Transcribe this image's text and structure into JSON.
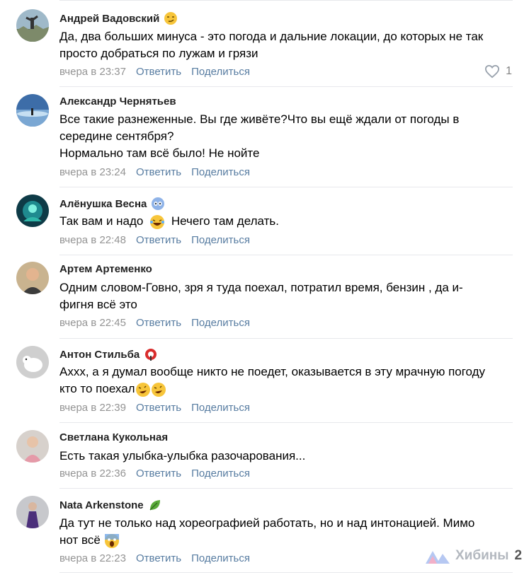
{
  "comments": [
    {
      "author": "Андрей Вадовский",
      "lines": [
        "Да, два больших минуса - это погода и дальние локации, до которых не так",
        "просто добраться по лужам и грязи"
      ],
      "time": "вчера в 23:37",
      "reply_label": "Ответить",
      "share_label": "Поделиться",
      "likes": "1"
    },
    {
      "author": "Александр Чернятьев",
      "lines": [
        "Все такие разнеженные. Вы где живёте?Что вы ещё ждали от погоды в",
        "середине сентября?",
        "Нормально там всё было! Не нойте"
      ],
      "time": "вчера в 23:24",
      "reply_label": "Ответить",
      "share_label": "Поделиться"
    },
    {
      "author": "Алёнушка Весна",
      "lines": [
        "Так вам и надо",
        "Нечего там делать."
      ],
      "time": "вчера в 22:48",
      "reply_label": "Ответить",
      "share_label": "Поделиться"
    },
    {
      "author": "Артем Артеменко",
      "lines": [
        "Одним словом-Говно, зря я туда поехал, потратил время, бензин , да и-",
        "фигня всё это"
      ],
      "time": "вчера в 22:45",
      "reply_label": "Ответить",
      "share_label": "Поделиться"
    },
    {
      "author": "Антон Стильба",
      "lines": [
        "Ахxх, а я думал вообще никто не поедет, оказывается в эту мрачную погоду",
        "кто то поехал"
      ],
      "time": "вчера в 22:39",
      "reply_label": "Ответить",
      "share_label": "Поделиться"
    },
    {
      "author": "Светлана Кукольная",
      "lines": [
        "Есть такая улыбка-улыбка разочарования..."
      ],
      "time": "вчера в 22:36",
      "reply_label": "Ответить",
      "share_label": "Поделиться"
    },
    {
      "author": "Nata Arkenstone",
      "lines": [
        "Да тут не только над хореографией работать, но и над интонацией. Мимо",
        "нот всё"
      ],
      "time": "вчера в 22:23",
      "reply_label": "Ответить",
      "share_label": "Поделиться"
    }
  ],
  "watermark": {
    "text": "Хибины",
    "extra": "2"
  },
  "colors": {
    "link": "#577ca1",
    "meta": "#939393",
    "divider": "#e7e8ec"
  }
}
